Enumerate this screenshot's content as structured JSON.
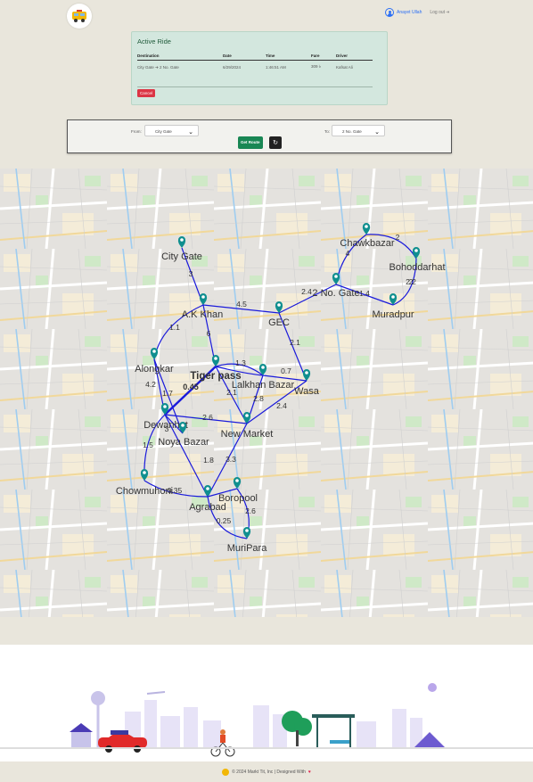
{
  "header": {
    "user_name": "Anayet Ullah",
    "logout_label": "Log out"
  },
  "active_ride": {
    "title": "Active Ride",
    "columns": [
      "Destination",
      "Date",
      "Time",
      "Fare",
      "Driver"
    ],
    "row": [
      "City Gate ➔ 2 No. Gate",
      "6/29/2024",
      "1:46:51 AM",
      "309 ৳",
      "Kafsat Ali"
    ],
    "cancel_label": "Cancel"
  },
  "route_form": {
    "from_label": "From:",
    "from_value": "City Gate",
    "to_label": "To:",
    "to_value": "2 No. Gate",
    "get_route_label": "Get Route"
  },
  "map": {
    "nodes": [
      {
        "id": "city-gate",
        "label": "City Gate"
      },
      {
        "id": "ak-khan",
        "label": "A.K Khan"
      },
      {
        "id": "gec",
        "label": "GEC"
      },
      {
        "id": "2-no-gate",
        "label": "2 No. Gate"
      },
      {
        "id": "chawkbazar",
        "label": "Chawkbazar"
      },
      {
        "id": "bohoddarhat",
        "label": "Bohoddarhat"
      },
      {
        "id": "muradpur",
        "label": "Muradpur"
      },
      {
        "id": "alongkar",
        "label": "Alongkar"
      },
      {
        "id": "tiger-pass",
        "label": "Tiger pass"
      },
      {
        "id": "lalkhan-bazar",
        "label": "Lalkhan Bazar"
      },
      {
        "id": "wasa",
        "label": "Wasa"
      },
      {
        "id": "dewanhat",
        "label": "Dewanhat"
      },
      {
        "id": "noya-bazar",
        "label": "Noya Bazar"
      },
      {
        "id": "new-market",
        "label": "New Market"
      },
      {
        "id": "chowmuhoni",
        "label": "Chowmuhoni"
      },
      {
        "id": "agrabad",
        "label": "Agrabad"
      },
      {
        "id": "boropool",
        "label": "Boropool"
      },
      {
        "id": "muripara",
        "label": "MuriPara"
      }
    ],
    "edge_labels": [
      "3",
      "4.5",
      "1.1",
      "6",
      "2.4",
      "2",
      "4",
      "2.2",
      "2",
      "1.4",
      "2.1",
      "1.3",
      "0.7",
      "4.2",
      "0.45",
      "1.7",
      "2.1",
      "2.8",
      "2.4",
      "2.6",
      "3",
      "1.5",
      "1.8",
      "3.3",
      "0.25",
      "0.35",
      "2.6"
    ],
    "route_color": "#1a1adb",
    "pin_color": "#0f8f8f"
  },
  "footer": {
    "copyright": "© 2024 Markt Tit, Inc | Designed With"
  }
}
